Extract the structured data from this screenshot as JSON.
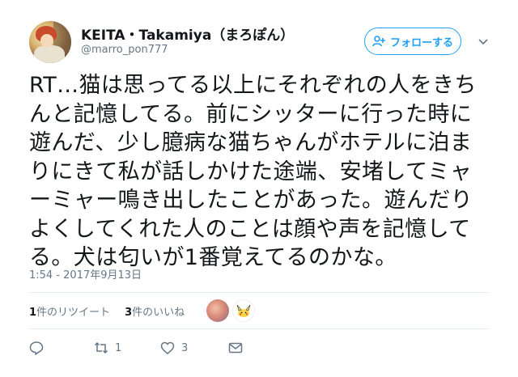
{
  "author": {
    "name": "KEITA・Takamiya（まろぽん）",
    "handle": "@marro_pon777"
  },
  "follow_button": {
    "label": "フォローする"
  },
  "tweet": {
    "text": "RT…猫は思ってる以上にそれぞれの人をきち\nんと記憶してる。前にシッターに行った時に\n遊んだ、少し臆病な猫ちゃんがホテルに泊ま\nりにきて私が話しかけた途端、安堵してミャ\nーミャー鳴き出したことがあった。遊んだり\nよくしてくれた人のことは顔や声を記憶して\nる。犬は匂いが1番覚えてるのかな。",
    "timestamp": "1:54 - 2017年9月13日"
  },
  "stats": {
    "retweets_count": "1",
    "retweets_label": "件のリツイート",
    "likes_count": "3",
    "likes_label": "件のいいね"
  },
  "actions": {
    "reply_count": "",
    "retweet_count": "1",
    "like_count": "3"
  },
  "icons": {
    "follow": "add-user-icon",
    "caret": "chevron-down-icon",
    "reply": "reply-icon",
    "retweet": "retweet-icon",
    "like": "heart-icon",
    "dm": "envelope-icon"
  },
  "colors": {
    "accent": "#1da1f2",
    "text": "#14171a",
    "muted": "#657786",
    "divider": "#e6ecf0"
  }
}
